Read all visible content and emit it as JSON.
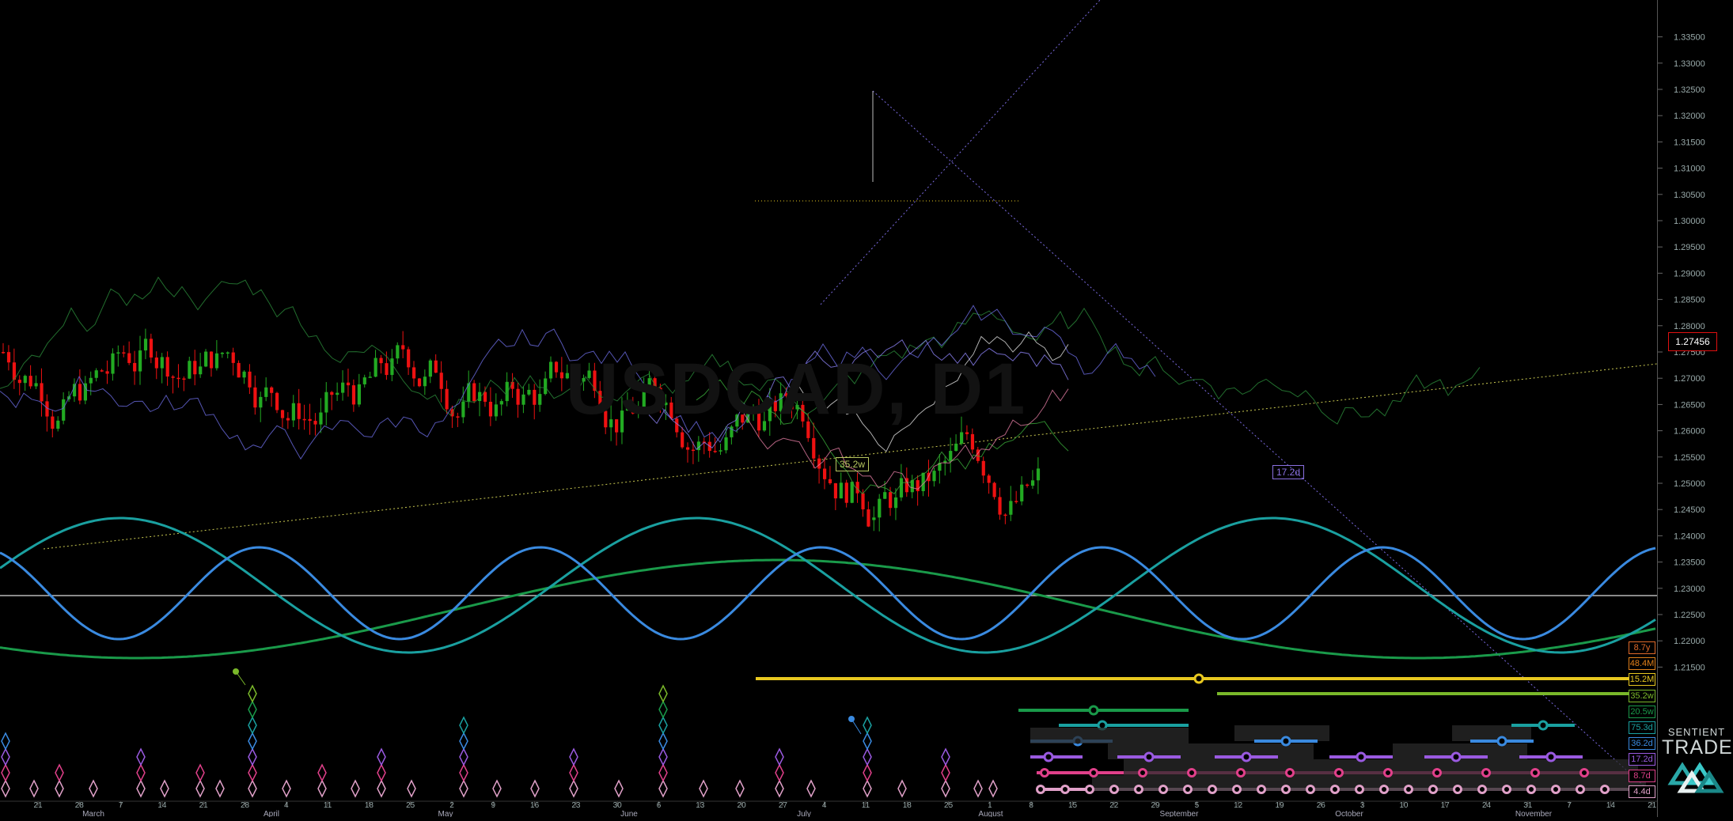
{
  "window": {
    "watermark": "USDCAD, D1",
    "brand_line1": "SENTIENT",
    "brand_line2": "TRADER"
  },
  "colors": {
    "background": "#000000",
    "candle_up": "#22aa22",
    "candle_down": "#ee1111",
    "axis_text": "#9aaaaa",
    "current_price_box": "#e01010",
    "trendline": "#c8c850"
  },
  "chart_data": {
    "type": "line",
    "title": "USDCAD, D1",
    "price_axis": {
      "ticks": [
        "1.33500",
        "1.33000",
        "1.32500",
        "1.32000",
        "1.31500",
        "1.31000",
        "1.30500",
        "1.30000",
        "1.29500",
        "1.29000",
        "1.28500",
        "1.28000",
        "1.27500",
        "1.27000",
        "1.26500",
        "1.26000",
        "1.25500",
        "1.25000",
        "1.24500",
        "1.24000",
        "1.23500",
        "1.23000",
        "1.22500",
        "1.22000",
        "1.21500"
      ],
      "range": [
        1.21,
        1.3375
      ],
      "current_price": "1.27456"
    },
    "time_axis": {
      "day_ticks": [
        "21",
        "28",
        "7",
        "14",
        "21",
        "28",
        "4",
        "11",
        "18",
        "25",
        "2",
        "9",
        "16",
        "23",
        "30",
        "6",
        "13",
        "20",
        "27",
        "4",
        "11",
        "18",
        "25",
        "1",
        "8",
        "15",
        "22",
        "29",
        "5",
        "12",
        "19",
        "26",
        "3",
        "10",
        "17",
        "24",
        "31",
        "7",
        "14",
        "21"
      ],
      "month_labels": [
        "March",
        "April",
        "May",
        "June",
        "July",
        "August",
        "September",
        "October",
        "November"
      ]
    },
    "annotations": [
      {
        "text": "35.2w",
        "color": "#b8c860"
      },
      {
        "text": "17.2d",
        "color": "#8a70e0"
      }
    ],
    "cycle_labels": [
      {
        "text": "8.7y",
        "color": "#e06a2a"
      },
      {
        "text": "48.4M",
        "color": "#e0801a"
      },
      {
        "text": "15.2M",
        "color": "#e8c820"
      },
      {
        "text": "35.2w",
        "color": "#7ab82a"
      },
      {
        "text": "20.5w",
        "color": "#1a9a4a"
      },
      {
        "text": "75.3d",
        "color": "#1aa0a0"
      },
      {
        "text": "36.2d",
        "color": "#3a8ae0"
      },
      {
        "text": "17.2d",
        "color": "#9a5ae0"
      },
      {
        "text": "8.7d",
        "color": "#e0408a"
      },
      {
        "text": "4.4d",
        "color": "#e0a0c8"
      }
    ],
    "grid": false
  }
}
